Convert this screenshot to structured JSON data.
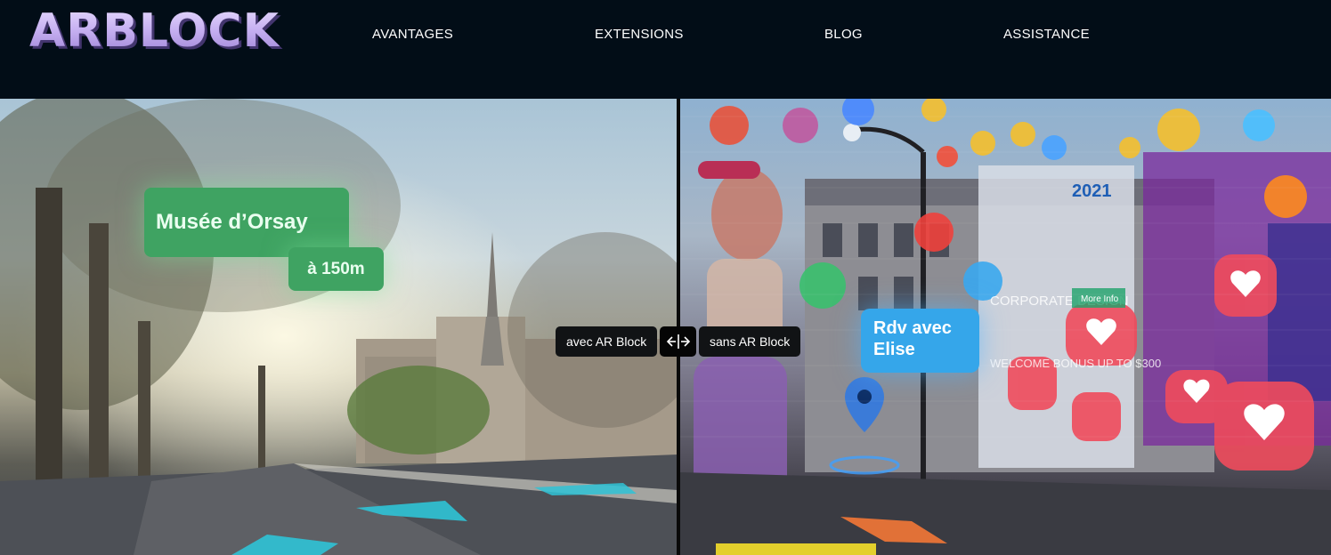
{
  "header": {
    "logo_text": "ARBLOCK",
    "nav": [
      {
        "label": "AVANTAGES"
      },
      {
        "label": "EXTENSIONS"
      },
      {
        "label": "BLOG"
      },
      {
        "label": "ASSISTANCE"
      }
    ]
  },
  "hero": {
    "left_overlay": {
      "place": "Musée d’Orsay",
      "distance": "à 150m"
    },
    "right_overlay": {
      "appointment": "Rdv avec Elise",
      "billboard_year": "2021",
      "billboard_heading": "CORPORATE DESIGN",
      "billboard_button": "More Info",
      "billboard_welcome": "WELCOME BONUS UP TO $300"
    },
    "comparison": {
      "with_label": "avec AR Block",
      "without_label": "sans AR Block",
      "handle_icon": "arrows-left-right-icon"
    }
  },
  "colors": {
    "header_bg": "#020d17",
    "nav_text": "#ffffff",
    "ar_green": "#3fa362",
    "ar_blue": "#35a6ea",
    "label_bg": "#111315",
    "arrow_cyan": "#2fc3d6"
  }
}
